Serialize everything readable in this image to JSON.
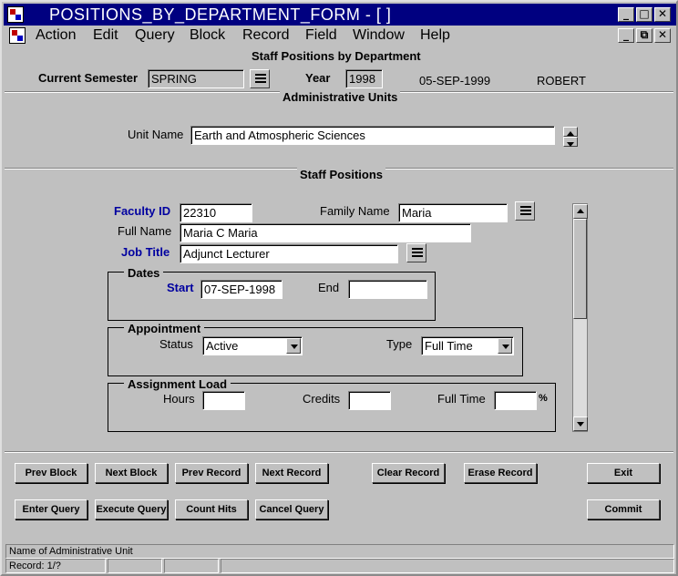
{
  "window": {
    "title": "POSITIONS_BY_DEPARTMENT_FORM - [ ]"
  },
  "menu": [
    "Action",
    "Edit",
    "Query",
    "Block",
    "Record",
    "Field",
    "Window",
    "Help"
  ],
  "form": {
    "title": "Staff Positions by Department",
    "current_semester_label": "Current Semester",
    "current_semester_value": "SPRING",
    "year_label": "Year",
    "year_value": "1998",
    "date": "05-SEP-1999",
    "user": "ROBERT"
  },
  "admin_units": {
    "section_title": "Administrative Units",
    "unit_name_label": "Unit Name",
    "unit_name_value": "Earth and Atmospheric Sciences"
  },
  "staff_positions": {
    "section_title": "Staff Positions",
    "faculty_id_label": "Faculty ID",
    "faculty_id_value": "22310",
    "family_name_label": "Family Name",
    "family_name_value": "Maria",
    "full_name_label": "Full Name",
    "full_name_value": "Maria C Maria",
    "job_title_label": "Job Title",
    "job_title_value": "Adjunct Lecturer",
    "dates": {
      "frame_title": "Dates",
      "start_label": "Start",
      "start_value": "07-SEP-1998",
      "end_label": "End",
      "end_value": ""
    },
    "appointment": {
      "frame_title": "Appointment",
      "status_label": "Status",
      "status_value": "Active",
      "type_label": "Type",
      "type_value": "Full Time"
    },
    "assignment_load": {
      "frame_title": "Assignment Load",
      "hours_label": "Hours",
      "hours_value": "",
      "credits_label": "Credits",
      "credits_value": "",
      "full_time_label": "Full Time",
      "full_time_value": "",
      "percent_symbol": "%"
    }
  },
  "buttons": {
    "prev_block": "Prev Block",
    "next_block": "Next Block",
    "prev_record": "Prev Record",
    "next_record": "Next Record",
    "clear_record": "Clear Record",
    "erase_record": "Erase Record",
    "exit": "Exit",
    "enter_query": "Enter Query",
    "execute_query": "Execute Query",
    "count_hits": "Count Hits",
    "cancel_query": "Cancel Query",
    "commit": "Commit"
  },
  "status": {
    "hint": "Name of Administrative Unit",
    "record": "Record: 1/?"
  },
  "colors": {
    "titlebar": "#000080",
    "label_blue": "#0000a0",
    "background": "#c0c0c0"
  }
}
